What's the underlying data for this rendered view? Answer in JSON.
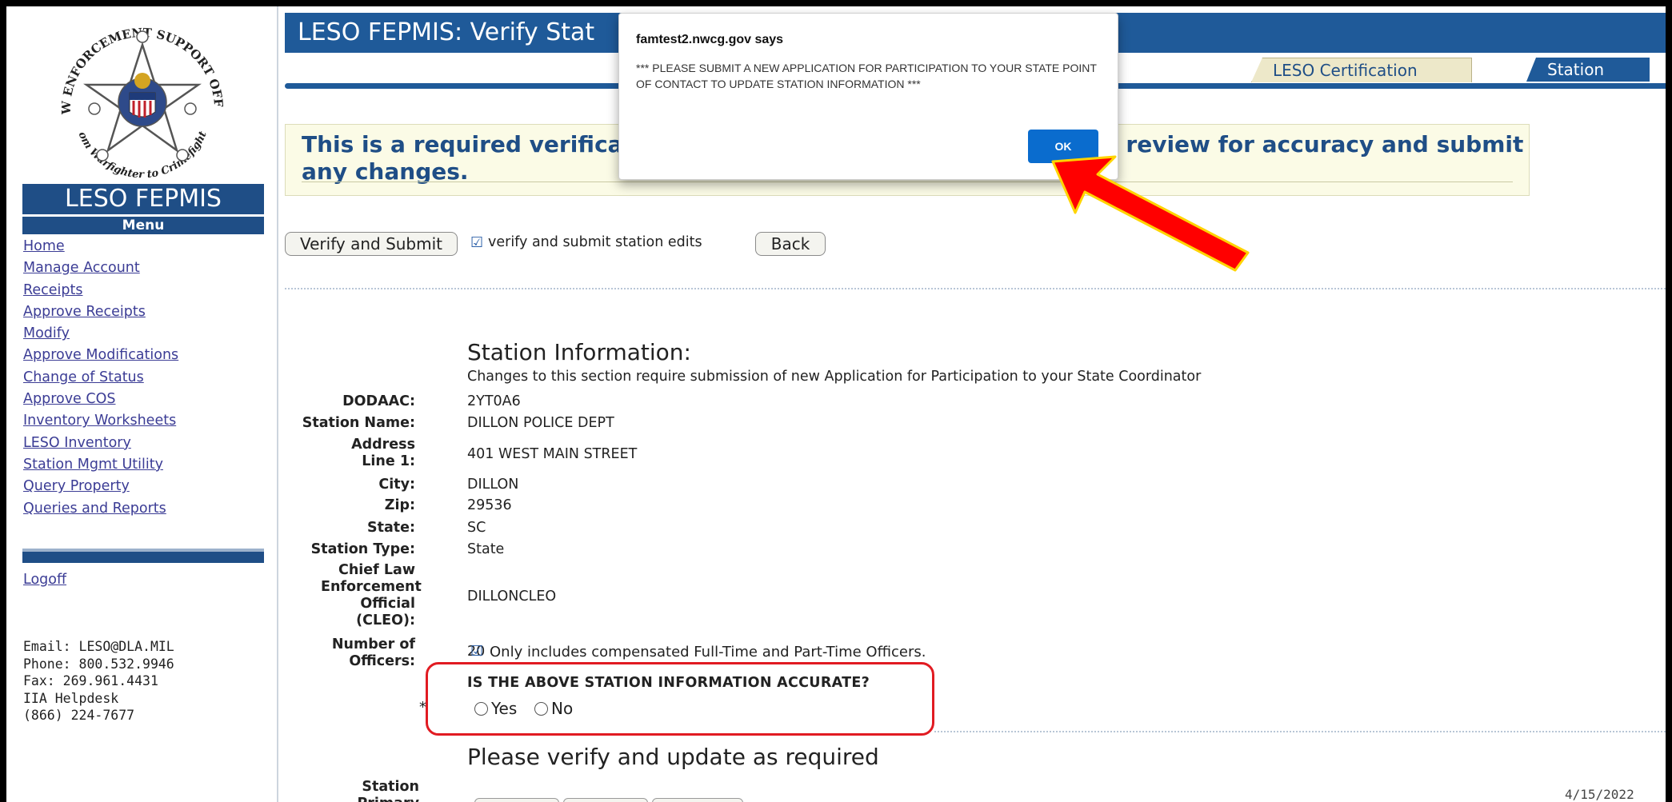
{
  "sidebar": {
    "brand": "LESO FEPMIS",
    "menu_title": "Menu",
    "menu": [
      "Home",
      "Manage Account",
      "Receipts",
      "Approve Receipts",
      "Modify",
      "Approve Modifications",
      "Change of Status",
      "Approve COS",
      "Inventory Worksheets",
      "LESO Inventory",
      "Station Mgmt Utility",
      "Query Property",
      "Queries and Reports"
    ],
    "logoff": "Logoff",
    "contact": [
      "Email: LESO@DLA.MIL",
      "Phone: 800.532.9946",
      "Fax: 269.961.4431",
      "IIA Helpdesk",
      "(866) 224-7677"
    ],
    "logo_text": {
      "top": "LAW ENFORCEMENT SUPPORT OFFICE",
      "bottom": "From Warfighter to Crimefighter"
    }
  },
  "header": {
    "title": "LESO FEPMIS: Verify Stat",
    "tabs": [
      "LESO Certification Search",
      "Station"
    ]
  },
  "notice": {
    "line1_left": "This is a required verificatio",
    "line1_right": "se review for accuracy and submit",
    "line2": "any changes."
  },
  "actions": {
    "verify_button": "Verify and Submit",
    "verify_note": "verify and submit station edits",
    "back_button": "Back"
  },
  "station": {
    "title": "Station Information:",
    "subtitle": "Changes to this section require submission of new Application for Participation to your State Coordinator",
    "fields": {
      "dodaac": {
        "label": "DODAAC:",
        "value": "2YT0A6"
      },
      "name": {
        "label": "Station Name:",
        "value": "DILLON POLICE DEPT"
      },
      "address": {
        "label": "Address Line 1:",
        "value": "401 WEST MAIN STREET"
      },
      "city": {
        "label": "City:",
        "value": "DILLON"
      },
      "zip": {
        "label": "Zip:",
        "value": "29536"
      },
      "state": {
        "label": "State:",
        "value": "SC"
      },
      "type": {
        "label": "Station Type:",
        "value": "State"
      },
      "cleo": {
        "label": "Chief Law Enforcement Official (CLEO):",
        "value": "DILLONCLEO"
      },
      "officers": {
        "label": "Number of Officers:",
        "value": "20",
        "note": "Only includes compensated Full-Time and Part-Time Officers."
      }
    },
    "accuracy_question": "IS THE ABOVE STATION INFORMATION ACCURATE?",
    "asterisk": "*",
    "yes": "Yes",
    "no": "No",
    "verify_title": "Please verify and update as required",
    "primary_label": "Station Primary",
    "date": "4/15/2022"
  },
  "dialog": {
    "title": "famtest2.nwcg.gov says",
    "message": "*** PLEASE SUBMIT A NEW APPLICATION FOR PARTICIPATION TO YOUR STATE POINT OF CONTACT TO UPDATE STATION INFORMATION ***",
    "ok": "OK"
  },
  "colors": {
    "navy": "#1f4e86",
    "header_blue": "#1f5a99",
    "highlight_red": "#e11b22",
    "dialog_ok": "#0a6cce"
  }
}
